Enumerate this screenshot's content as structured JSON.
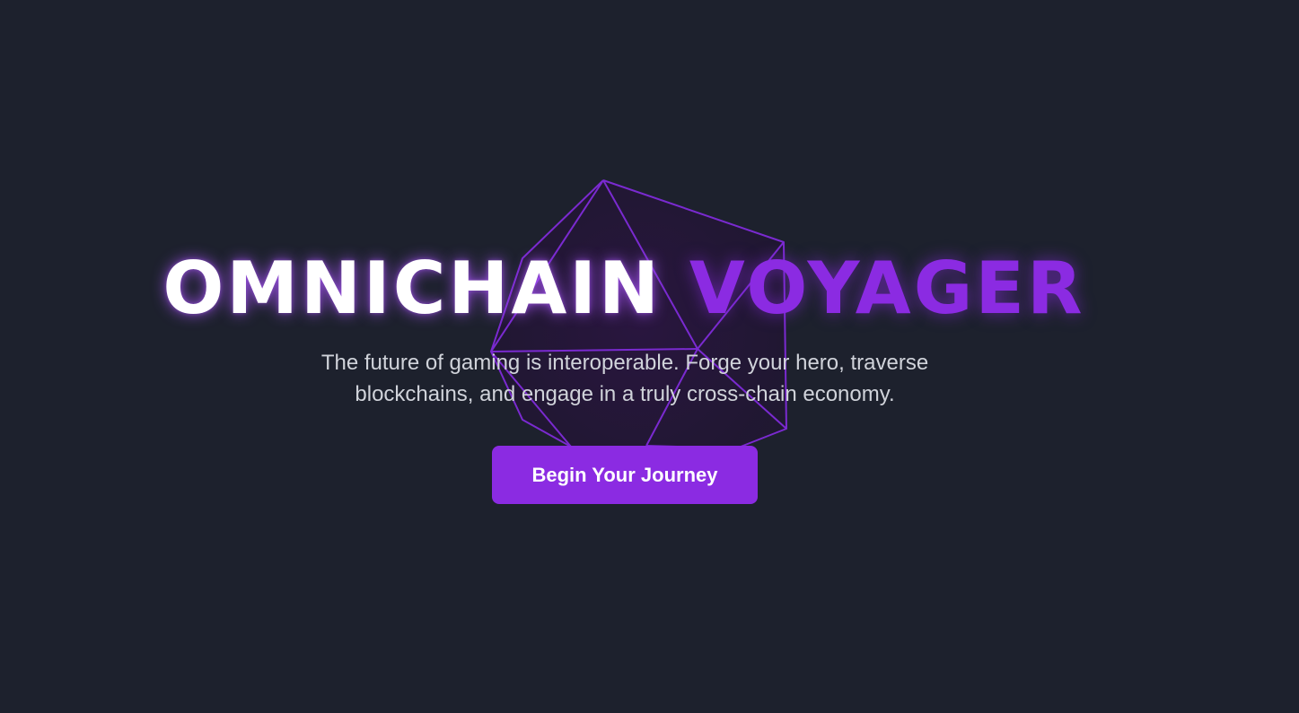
{
  "hero": {
    "title_part_1": "OMNICHAIN",
    "title_part_2": "VOYAGER",
    "subtitle": "The future of gaming is interoperable. Forge your hero, traverse blockchains, and engage in a truly cross-chain economy.",
    "cta_label": "Begin Your Journey"
  },
  "colors": {
    "background": "#1d212d",
    "accent": "#8b2be2",
    "title_white": "#ffffff",
    "subtitle_text": "#d0d3da",
    "wireframe_stroke": "#7a2ad0"
  },
  "icons": {
    "decoration": "wireframe-polyhedron"
  }
}
